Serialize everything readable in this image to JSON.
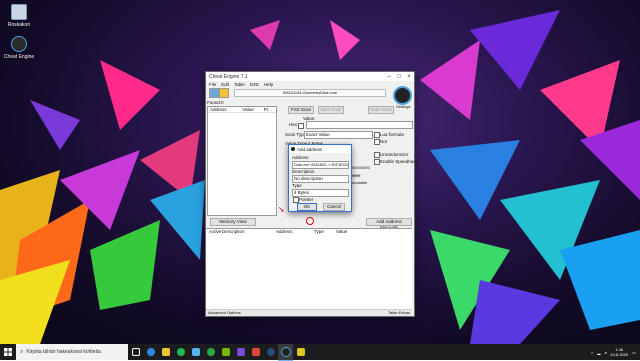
{
  "desktop": {
    "icons": [
      {
        "label": "Roskakori"
      },
      {
        "label": "Cheat Engine"
      }
    ]
  },
  "window": {
    "title": "Cheat Engine 7.1",
    "process": "00001D34-GeometryDash.exe",
    "menu": [
      "File",
      "Edit",
      "Table",
      "D3D",
      "Help"
    ],
    "found_label": "Found:0",
    "columns": [
      "Address",
      "Value",
      "Pr..."
    ],
    "first_scan": "First Scan",
    "next_scan": "Next Scan",
    "undo_scan": "Undo Scan",
    "settings": "Settings",
    "value_label": "Value:",
    "hex_label": "Hex",
    "scan_type_label": "Scan Type",
    "scan_type_value": "Exact Value",
    "value_type_label": "Value Type",
    "value_type_value": "4 Bytes",
    "lua_formula": "Lua formula",
    "not_label": "Not",
    "unrandomizer": "Unrandomizer",
    "enable_speedhack": "Enable Speedhack",
    "executable": "ecutable",
    "hex_digits_1": "00000000",
    "hex_digits_2": "ffffffff",
    "memory_view": "Memory View",
    "add_address_manually": "Add Address Manually",
    "table_columns": [
      "Active",
      "Description",
      "Address",
      "Type",
      "Value"
    ],
    "advanced_options": "Advanced Options",
    "table_extras": "Table Extras"
  },
  "dialog": {
    "title": "Add address",
    "address_label": "Address",
    "address_value": "Dash.exe+20A1B00 -> 0DF1B7D0",
    "description_label": "Description",
    "description_value": "No description",
    "type_label": "Type",
    "type_value": "4 Bytes",
    "pointer_label": "Pointer",
    "ok": "OK",
    "cancel": "Cancel"
  },
  "taskbar": {
    "search_placeholder": "Kirjoita tähän hakeaksesi kohteita",
    "time": "1.46",
    "date": "24.6.2020"
  },
  "colors": {
    "accent": "#3b6ed1",
    "taskbar": "#1c1c1e"
  }
}
